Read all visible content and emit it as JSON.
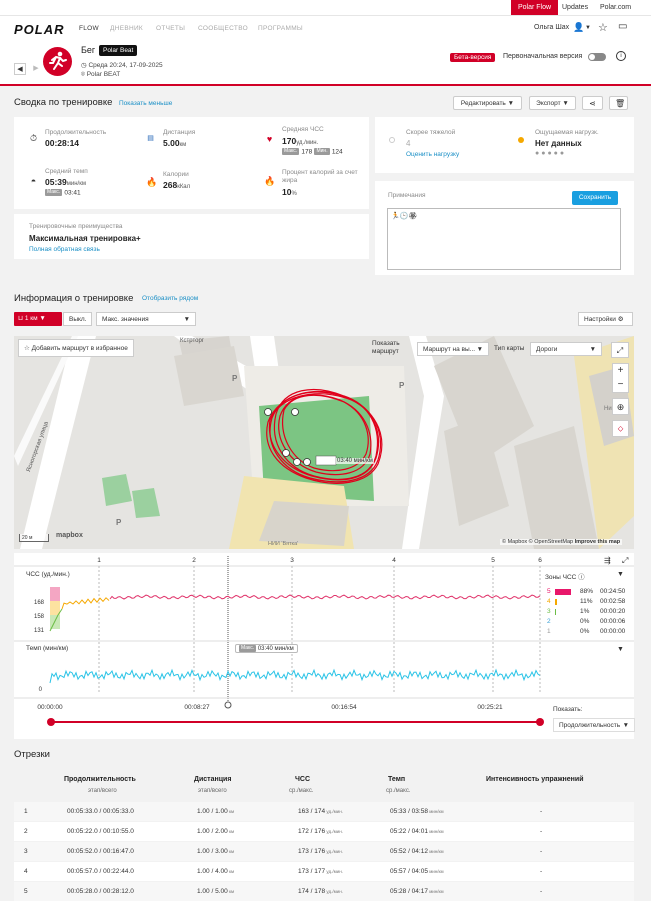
{
  "topbar": {
    "links": [
      "Polar Flow",
      "Updates",
      "Polar.com"
    ],
    "active": 0
  },
  "nav": {
    "logo": "POLAR",
    "flow": "FLOW",
    "items": [
      "ДНЕВНИК",
      "ОТЧЕТЫ",
      "СООБЩЕСТВО",
      "ПРОГРАММЫ"
    ],
    "user": "Ольга Шах"
  },
  "session": {
    "sport": "Бег",
    "device_badge": "Polar Beat",
    "datetime": "Среда 20:24, 17-09-2025",
    "device": "Polar BEAT",
    "beta": "Бета-версия",
    "original_version": "Первоначальная версия"
  },
  "summary": {
    "title": "Сводка по тренировке",
    "show_less": "Показать меньше",
    "edit": "Редактировать",
    "export": "Экспорт",
    "duration_label": "Продолжительность",
    "duration": "00:28:14",
    "distance_label": "Дистанция",
    "distance": "5.00",
    "distance_unit": "км",
    "hr_label": "Средняя ЧСС",
    "hr_avg": "170",
    "hr_unit": "уд./мин.",
    "hr_max_label": "Макс.",
    "hr_max": "178",
    "hr_min_label": "Мин.",
    "hr_min": "124",
    "pace_label": "Средний темп",
    "pace": "05:39",
    "pace_unit": "мин/км",
    "pace_max_label": "Макс.",
    "pace_max": "03:41",
    "calories_label": "Калории",
    "calories": "268",
    "calories_unit": "кКал",
    "fat_label": "Процент калорий за счет жира",
    "fat": "10",
    "fat_unit": "%",
    "benefit_label": "Тренировочные преимущества",
    "benefit": "Максимальная тренировка+",
    "benefit_link": "Полная обратная связь",
    "recovery_label": "Скорее тяжелой",
    "recovery_value": "4",
    "recovery_link": "Оценить нагрузку",
    "perceived_label": "Ощущаемая нагрузк.",
    "perceived_value": "Нет данных",
    "notes_label": "Примечания",
    "save": "Сохранить",
    "notes_icons": "🏃🕒🏵"
  },
  "training_info": {
    "title": "Информация о тренировке",
    "show_row": "Отобразить рядом",
    "lap_btn": "1 км",
    "off": "Выкл.",
    "max_select": "Макс. значения",
    "settings": "Настройки"
  },
  "map": {
    "add_fav": "Добавить маршрут в избранное",
    "show_route": "Показать маршрут",
    "route_select": "Маршрут на вы...",
    "map_type_label": "Тип карты",
    "map_type": "Дороги",
    "street1": "Кстрторг",
    "street2": "Ясногорская улица",
    "street3": "Ницей",
    "scale": "20 м",
    "marker": "03:40 мин/км",
    "credit": "© Mapbox © OpenStreetMap",
    "improve": "Improve this map",
    "mapbox": "mapbox",
    "parking": "P",
    "hospital": "НИИ 'Вятка'"
  },
  "chart_data": [
    {
      "type": "line",
      "title": "ЧСС (уд./мин.)",
      "y_ticks": [
        168,
        158,
        131
      ],
      "lap_markers": [
        "1",
        "2",
        "3",
        "4",
        "5",
        "6"
      ]
    },
    {
      "type": "line",
      "title": "Темп (мин/км)",
      "y_ticks": [
        0
      ],
      "max_label": "Макс.",
      "max_value": "03:40 мин/км"
    }
  ],
  "zones": {
    "title": "Зоны ЧСС",
    "items": [
      {
        "zone": "5",
        "pct": "88%",
        "time": "00:24:50",
        "color": "#e8176a"
      },
      {
        "zone": "4",
        "pct": "11%",
        "time": "00:02:58",
        "color": "#f5a800"
      },
      {
        "zone": "3",
        "pct": "1%",
        "time": "00:00:20",
        "color": "#6cbd45"
      },
      {
        "zone": "2",
        "pct": "0%",
        "time": "00:00:06",
        "color": "#3aa0d5"
      },
      {
        "zone": "1",
        "pct": "0%",
        "time": "00:00:00",
        "color": "#999"
      }
    ]
  },
  "timeline": {
    "ticks": [
      "00:00:00",
      "00:08:27",
      "00:16:54",
      "00:25:21"
    ],
    "show_label": "Показать:",
    "show_select": "Продолжительность"
  },
  "laps": {
    "title": "Отрезки",
    "headers": [
      {
        "t": "Продолжительность",
        "s": "этап/всего"
      },
      {
        "t": "Дистанция",
        "s": "этап/всего"
      },
      {
        "t": "ЧСС",
        "s": "ср./макс."
      },
      {
        "t": "Темп",
        "s": "ср./макс."
      },
      {
        "t": "Интенсивность упражнений",
        "s": ""
      }
    ],
    "rows": [
      {
        "n": "1",
        "dur": "00:05:33.0 / 00:05:33.0",
        "dist": "1.00 / 1.00",
        "hr": "163 / 174",
        "pace": "05:33 / 03:58",
        "int": "-"
      },
      {
        "n": "2",
        "dur": "00:05:22.0 / 00:10:55.0",
        "dist": "1.00 / 2.00",
        "hr": "172 / 176",
        "pace": "05:22 / 04:01",
        "int": "-"
      },
      {
        "n": "3",
        "dur": "00:05:52.0 / 00:16:47.0",
        "dist": "1.00 / 3.00",
        "hr": "173 / 176",
        "pace": "05:52 / 04:12",
        "int": "-"
      },
      {
        "n": "4",
        "dur": "00:05:57.0 / 00:22:44.0",
        "dist": "1.00 / 4.00",
        "hr": "173 / 177",
        "pace": "05:57 / 04:05",
        "int": "-"
      },
      {
        "n": "5",
        "dur": "00:05:28.0 / 00:28:12.0",
        "dist": "1.00 / 5.00",
        "hr": "174 / 178",
        "pace": "05:28 / 04:17",
        "int": "-"
      }
    ],
    "units": {
      "dist": "км",
      "hr": "уд./мин.",
      "pace": "мин/км"
    }
  }
}
